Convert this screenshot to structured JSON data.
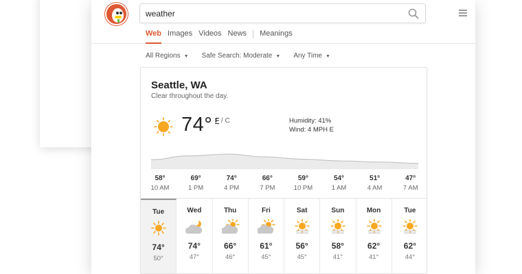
{
  "search": {
    "query": "weather"
  },
  "tabs": [
    {
      "label": "Web",
      "active": true
    },
    {
      "label": "Images",
      "active": false
    },
    {
      "label": "Videos",
      "active": false
    },
    {
      "label": "News",
      "active": false
    },
    {
      "label": "Meanings",
      "active": false
    }
  ],
  "filters": [
    {
      "label": "All Regions"
    },
    {
      "label": "Safe Search: Moderate"
    },
    {
      "label": "Any Time"
    }
  ],
  "weather": {
    "location": "Seattle, WA",
    "summary": "Clear throughout the day.",
    "current_temp": "74°",
    "unit_f": "F",
    "unit_sep": " / ",
    "unit_c": "C",
    "humidity": "Humidity: 41%",
    "wind": "Wind: 4 MPH E",
    "hourly": [
      {
        "temp": "58°",
        "time": "10 AM",
        "value": 58
      },
      {
        "temp": "69°",
        "time": "1 PM",
        "value": 69
      },
      {
        "temp": "74°",
        "time": "4 PM",
        "value": 74
      },
      {
        "temp": "66°",
        "time": "7 PM",
        "value": 66
      },
      {
        "temp": "59°",
        "time": "10 PM",
        "value": 59
      },
      {
        "temp": "54°",
        "time": "1 AM",
        "value": 54
      },
      {
        "temp": "51°",
        "time": "4 AM",
        "value": 51
      },
      {
        "temp": "47°",
        "time": "7 AM",
        "value": 47
      }
    ],
    "daily": [
      {
        "day": "Tue",
        "icon": "sun-icon",
        "high": "74°",
        "low": "50°",
        "selected": true
      },
      {
        "day": "Wed",
        "icon": "cloud-moon-icon",
        "high": "74°",
        "low": "47°",
        "selected": false
      },
      {
        "day": "Thu",
        "icon": "partly-cloudy-icon",
        "high": "66°",
        "low": "46°",
        "selected": false
      },
      {
        "day": "Fri",
        "icon": "partly-cloudy-icon",
        "high": "61°",
        "low": "45°",
        "selected": false
      },
      {
        "day": "Sat",
        "icon": "fog-sun-icon",
        "high": "56°",
        "low": "45°",
        "selected": false
      },
      {
        "day": "Sun",
        "icon": "fog-sun-icon",
        "high": "58°",
        "low": "41°",
        "selected": false
      },
      {
        "day": "Mon",
        "icon": "fog-sun-icon",
        "high": "62°",
        "low": "41°",
        "selected": false
      },
      {
        "day": "Tue",
        "icon": "fog-sun-icon",
        "high": "62°",
        "low": "44°",
        "selected": false
      }
    ]
  },
  "colors": {
    "accent": "#de5833",
    "sun": "#f7a823",
    "cloud": "#c8c8c8"
  }
}
